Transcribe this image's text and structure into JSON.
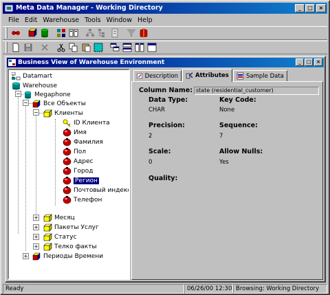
{
  "window": {
    "title": "Meta Data Manager - Working Directory",
    "min": "_",
    "max": "□",
    "close": "×"
  },
  "menu": [
    "File",
    "Edit",
    "Warehouse",
    "Tools",
    "Window",
    "Help"
  ],
  "child": {
    "title": "Business View of Warehouse Environment"
  },
  "tree": {
    "datamart": "Datamart",
    "warehouse": "Warehouse",
    "megaphone": "Megaphone",
    "all_objects": "Все Объекты",
    "clients": "Клиенты",
    "client_id": "ID Клиента",
    "name": "Имя",
    "surname": "Фамилия",
    "gender": "Пол",
    "address": "Адрес",
    "city": "Город",
    "region": "Регион",
    "postal": "Почтовый индекс",
    "phone": "Телефон",
    "month": "Месяц",
    "packages": "Пакеты Услуг",
    "status": "Статус",
    "telco": "Телко факты",
    "periods": "Периоды Времени"
  },
  "tabs": {
    "description": "Description",
    "attributes": "Attributes",
    "sample": "Sample Data"
  },
  "attributes": {
    "column_name_label": "Column Name:",
    "column_name_value": "state (residential_customer)",
    "data_type_label": "Data Type:",
    "data_type_value": "CHAR",
    "key_code_label": "Key Code:",
    "key_code_value": "None",
    "precision_label": "Precision:",
    "precision_value": "2",
    "sequence_label": "Sequence:",
    "sequence_value": "7",
    "scale_label": "Scale:",
    "scale_value": "0",
    "allow_nulls_label": "Allow Nulls:",
    "allow_nulls_value": "Yes",
    "quality_label": "Quality:"
  },
  "status": {
    "ready": "Ready",
    "datetime": "06/26/00 12:30",
    "browsing": "Browsing: Working Directory"
  }
}
